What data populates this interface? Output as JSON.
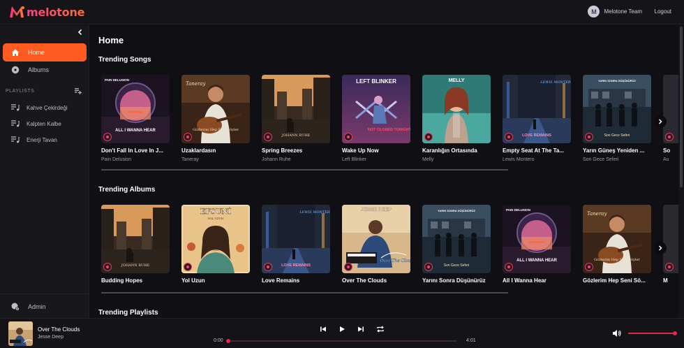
{
  "app": {
    "name": "melotone"
  },
  "header": {
    "user_initial": "M",
    "user_name": "Melotone Team",
    "logout_label": "Logout"
  },
  "sidebar": {
    "nav": [
      {
        "label": "Home",
        "active": true
      },
      {
        "label": "Albums",
        "active": false
      }
    ],
    "playlists_heading": "PLAYLISTS",
    "playlists": [
      "Kahve Çekirdeği",
      "Kalpten Kalbe",
      "Enerji Tavan"
    ],
    "admin_label": "Admin"
  },
  "main": {
    "page_title": "Home",
    "trending_songs": {
      "title": "Trending Songs",
      "items": [
        {
          "title": "Don't Fall In Love In J...",
          "artist": "Pain Delusion",
          "art": "sunset-portal",
          "cover_text": "ALL I WANNA HEAR",
          "cover_top": "PAIN DELUSION"
        },
        {
          "title": "Uzaklardasın",
          "artist": "Taneray",
          "art": "guitarist",
          "cover_text": "Gözlerim Hep Seni Söyler",
          "cover_top": "Taneray"
        },
        {
          "title": "Spring Breezes",
          "artist": "Johann Ruhe",
          "art": "city-dusk",
          "cover_text": "JOHANN RUHE",
          "cover_top": ""
        },
        {
          "title": "Wake Up Now",
          "artist": "Left Blinker",
          "art": "left-blinker",
          "cover_text": "NOT CLOSED TONIGHT",
          "cover_top": "LEFT BLINKER"
        },
        {
          "title": "Karanlığın Ortasında",
          "artist": "Melly",
          "art": "melly",
          "cover_text": "",
          "cover_top": "MELLY"
        },
        {
          "title": "Empty Seat At The Ta...",
          "artist": "Lewis Montero",
          "art": "neon-street",
          "cover_text": "LOVE REMAINS",
          "cover_top": "LEWIS MONTERO"
        },
        {
          "title": "Yarın Güneş Yeniden ...",
          "artist": "Son Gece Seferi",
          "art": "band",
          "cover_text": "Son Gece Seferi",
          "cover_top": "YARIN SONRA DÜŞÜNÜRÜZ"
        },
        {
          "title": "So",
          "artist": "Au",
          "art": "dark",
          "cover_text": "",
          "cover_top": ""
        }
      ]
    },
    "trending_albums": {
      "title": "Trending Albums",
      "items": [
        {
          "title": "Budding Hopes",
          "artist": "",
          "art": "city-dusk",
          "cover_text": "JOHANN RUHE",
          "cover_top": ""
        },
        {
          "title": "Yol Uzun",
          "artist": "",
          "art": "efsuni",
          "cover_text": "YOL UZUN",
          "cover_top": "EFSUNİ"
        },
        {
          "title": "Love Remains",
          "artist": "",
          "art": "neon-street",
          "cover_text": "LOVE REMAINS",
          "cover_top": "LEWIS MONTERO"
        },
        {
          "title": "Over The Clouds",
          "artist": "",
          "art": "jesse-deep",
          "cover_text": "Over The Clouds",
          "cover_top": "JESSE DEEP"
        },
        {
          "title": "Yarını Sonra Düşünürüz",
          "artist": "",
          "art": "band",
          "cover_text": "Son Gece Seferi",
          "cover_top": "YARIN SONRA DÜŞÜNÜRÜZ"
        },
        {
          "title": "All I Wanna Hear",
          "artist": "",
          "art": "sunset-portal",
          "cover_text": "ALL I WANNA HEAR",
          "cover_top": "PAIN DELUSION"
        },
        {
          "title": "Gözlerim Hep Seni Sö...",
          "artist": "",
          "art": "guitarist",
          "cover_text": "Gözlerim Hep Seni Söyler",
          "cover_top": "Taneray"
        },
        {
          "title": "M",
          "artist": "",
          "art": "dark",
          "cover_text": "",
          "cover_top": ""
        }
      ]
    },
    "trending_playlists": {
      "title": "Trending Playlists"
    },
    "next_icon": "chevron-right-icon"
  },
  "player": {
    "title": "Over The Clouds",
    "artist": "Jesse Deep",
    "current_time": "0:00",
    "duration": "4:01",
    "progress": 0,
    "volume": 1.0,
    "accent": "#e8254a"
  },
  "colors": {
    "brand": "#ff5a1f",
    "background": "#101014",
    "sidebar": "#17171c"
  }
}
